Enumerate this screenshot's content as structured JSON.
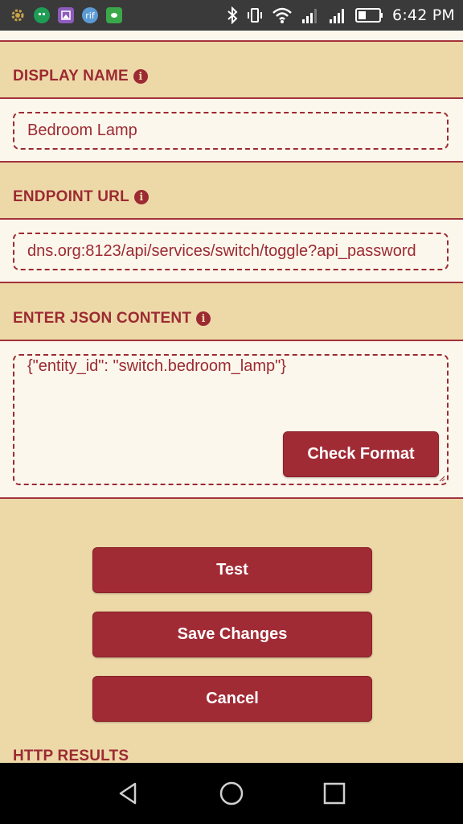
{
  "status_bar": {
    "time": "6:42 PM",
    "left_icons": [
      "tasker-gear-icon",
      "hangouts-icon",
      "gallery-icon",
      "rif-icon",
      "app-icon"
    ],
    "rif_label": "rif",
    "right_icons": [
      "bluetooth-icon",
      "vibrate-icon",
      "wifi-icon",
      "signal-icon",
      "signal-icon",
      "battery-icon"
    ]
  },
  "display_name": {
    "label": "DISPLAY NAME",
    "value": "Bedroom Lamp"
  },
  "endpoint_url": {
    "label": "ENDPOINT URL",
    "value": "dns.org:8123/api/services/switch/toggle?api_password"
  },
  "json_content": {
    "label": "ENTER JSON CONTENT",
    "value": "{\"entity_id\": \"switch.bedroom_lamp\"}",
    "check_format_label": "Check Format"
  },
  "actions": {
    "test_label": "Test",
    "save_label": "Save Changes",
    "cancel_label": "Cancel"
  },
  "results": {
    "label": "HTTP RESULTS"
  },
  "nav": {
    "icons": [
      "back-icon",
      "home-icon",
      "recents-icon"
    ]
  },
  "colors": {
    "background": "#EDD9A8",
    "accent": "#9C2A33",
    "button": "#A12B35",
    "field_bg": "#FCF7EC"
  }
}
